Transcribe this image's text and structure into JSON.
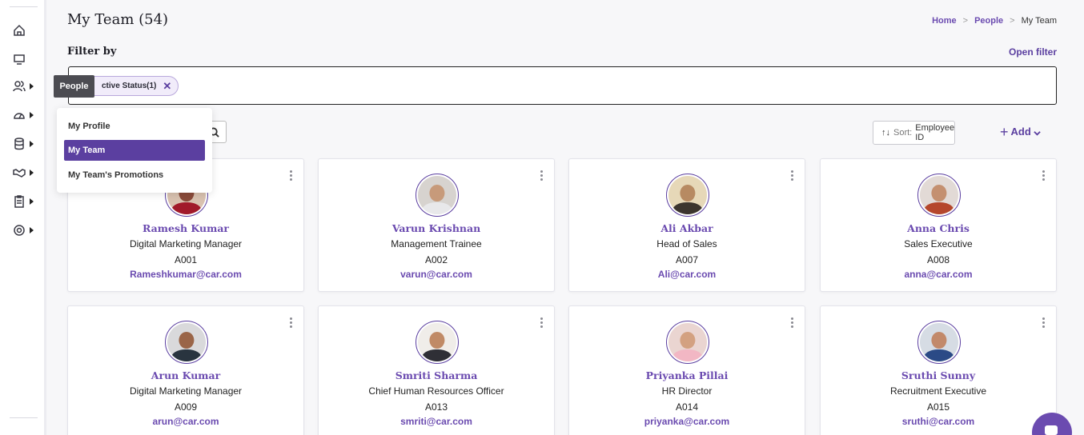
{
  "header": {
    "title": "My Team (54)",
    "breadcrumb": [
      "Home",
      "People",
      "My Team"
    ],
    "breadcrumb_sep": ">"
  },
  "filter": {
    "label": "Filter by",
    "open_label": "Open filter",
    "chip_label": "ctive Status(1)",
    "chip_remove": "✕"
  },
  "tooltip": "People",
  "people_menu": {
    "items": [
      {
        "label": "My Profile",
        "active": false
      },
      {
        "label": "My Team",
        "active": true
      },
      {
        "label": "My Team's Promotions",
        "active": false
      }
    ]
  },
  "toolbar": {
    "sort_icon": "↑↓",
    "sort_label": "Sort:",
    "sort_value": "Employee ID",
    "add_label": "Add"
  },
  "cards": [
    {
      "name": "Ramesh Kumar",
      "role": "Digital Marketing Manager",
      "id": "A001",
      "email": "Rameshkumar@car.com",
      "skin": "#8a4b3a",
      "shirt": "#a11a2a",
      "bg": "#d9c2b0"
    },
    {
      "name": "Varun Krishnan",
      "role": "Management Trainee",
      "id": "A002",
      "email": "varun@car.com",
      "skin": "#c79a7a",
      "shirt": "#e8e8ea",
      "bg": "#d7d3cf"
    },
    {
      "name": "Ali Akbar",
      "role": "Head of Sales",
      "id": "A007",
      "email": "Ali@car.com",
      "skin": "#b78a62",
      "shirt": "#3c352e",
      "bg": "#e6d8b8"
    },
    {
      "name": "Anna Chris",
      "role": "Sales Executive",
      "id": "A008",
      "email": "anna@car.com",
      "skin": "#c49070",
      "shirt": "#b5472c",
      "bg": "#e2dad6"
    },
    {
      "name": "Arun Kumar",
      "role": "Digital Marketing Manager",
      "id": "A009",
      "email": "arun@car.com",
      "skin": "#9a6548",
      "shirt": "#29343f",
      "bg": "#d9d9db"
    },
    {
      "name": "Smriti Sharma",
      "role": "Chief Human Resources Officer",
      "id": "A013",
      "email": "smriti@car.com",
      "skin": "#c08a66",
      "shirt": "#2f2f36",
      "bg": "#f0ede9"
    },
    {
      "name": "Priyanka Pillai",
      "role": "HR Director",
      "id": "A014",
      "email": "priyanka@car.com",
      "skin": "#d3a181",
      "shirt": "#f2b7c4",
      "bg": "#ead5d1"
    },
    {
      "name": "Sruthi Sunny",
      "role": "Recruitment Executive",
      "id": "A015",
      "email": "sruthi@car.com",
      "skin": "#c2896a",
      "shirt": "#2b4a86",
      "bg": "#d6dce4"
    }
  ],
  "colors": {
    "accent": "#5b3fa0",
    "link": "#6b4bb0"
  }
}
